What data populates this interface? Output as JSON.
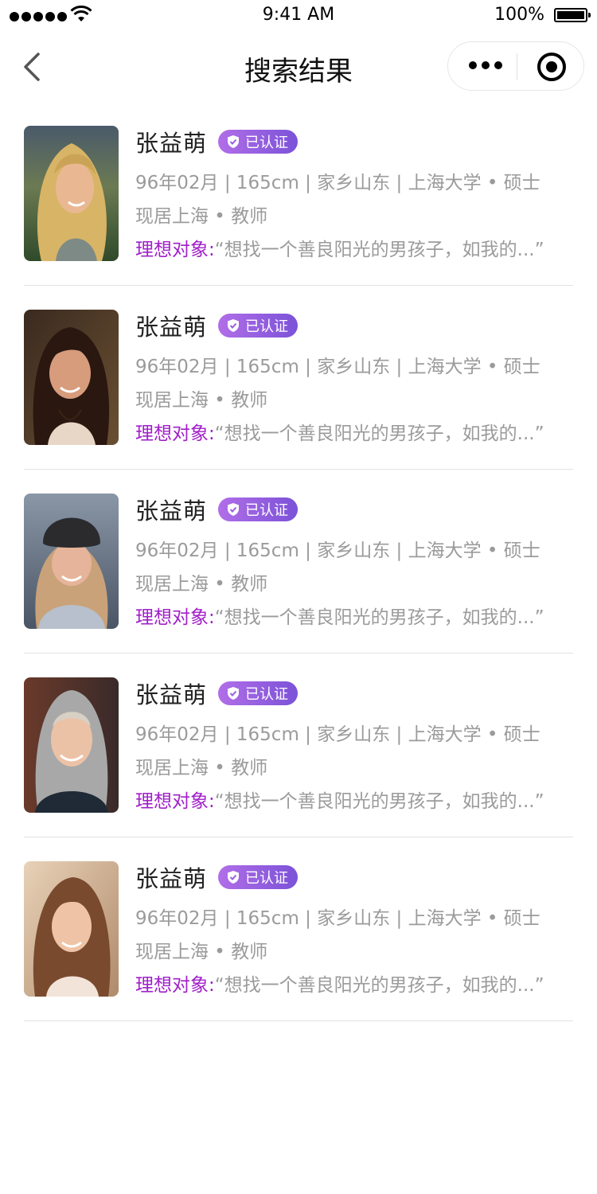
{
  "status_bar": {
    "time": "9:41 AM",
    "battery": "100%"
  },
  "nav": {
    "title": "搜索结果"
  },
  "results": [
    {
      "name": "张益萌",
      "badge": "已认证",
      "info": "96年02月 | 165cm | 家乡山东 | 上海大学 • 硕士",
      "location": "现居上海 • 教师",
      "ideal_label": "理想对象:",
      "ideal_text": "“想找一个善良阳光的男孩子，如我的...”"
    },
    {
      "name": "张益萌",
      "badge": "已认证",
      "info": "96年02月 | 165cm | 家乡山东 | 上海大学 • 硕士",
      "location": "现居上海 • 教师",
      "ideal_label": "理想对象:",
      "ideal_text": "“想找一个善良阳光的男孩子，如我的...”"
    },
    {
      "name": "张益萌",
      "badge": "已认证",
      "info": "96年02月 | 165cm | 家乡山东 | 上海大学 • 硕士",
      "location": "现居上海 • 教师",
      "ideal_label": "理想对象:",
      "ideal_text": "“想找一个善良阳光的男孩子，如我的...”"
    },
    {
      "name": "张益萌",
      "badge": "已认证",
      "info": "96年02月 | 165cm | 家乡山东 | 上海大学 • 硕士",
      "location": "现居上海 • 教师",
      "ideal_label": "理想对象:",
      "ideal_text": "“想找一个善良阳光的男孩子，如我的...”"
    },
    {
      "name": "张益萌",
      "badge": "已认证",
      "info": "96年02月 | 165cm | 家乡山东 | 上海大学 • 硕士",
      "location": "现居上海 • 教师",
      "ideal_label": "理想对象:",
      "ideal_text": "“想找一个善良阳光的男孩子，如我的...”"
    }
  ],
  "colors": {
    "badge_start": "#b16ee8",
    "badge_end": "#7b52d8",
    "ideal_label": "#a020c8",
    "secondary_text": "#9b9b9b"
  },
  "icons": [
    "signal-icon",
    "wifi-icon",
    "battery-icon",
    "back-arrow-icon",
    "more-icon",
    "close-miniprogram-icon",
    "verified-shield-icon"
  ]
}
